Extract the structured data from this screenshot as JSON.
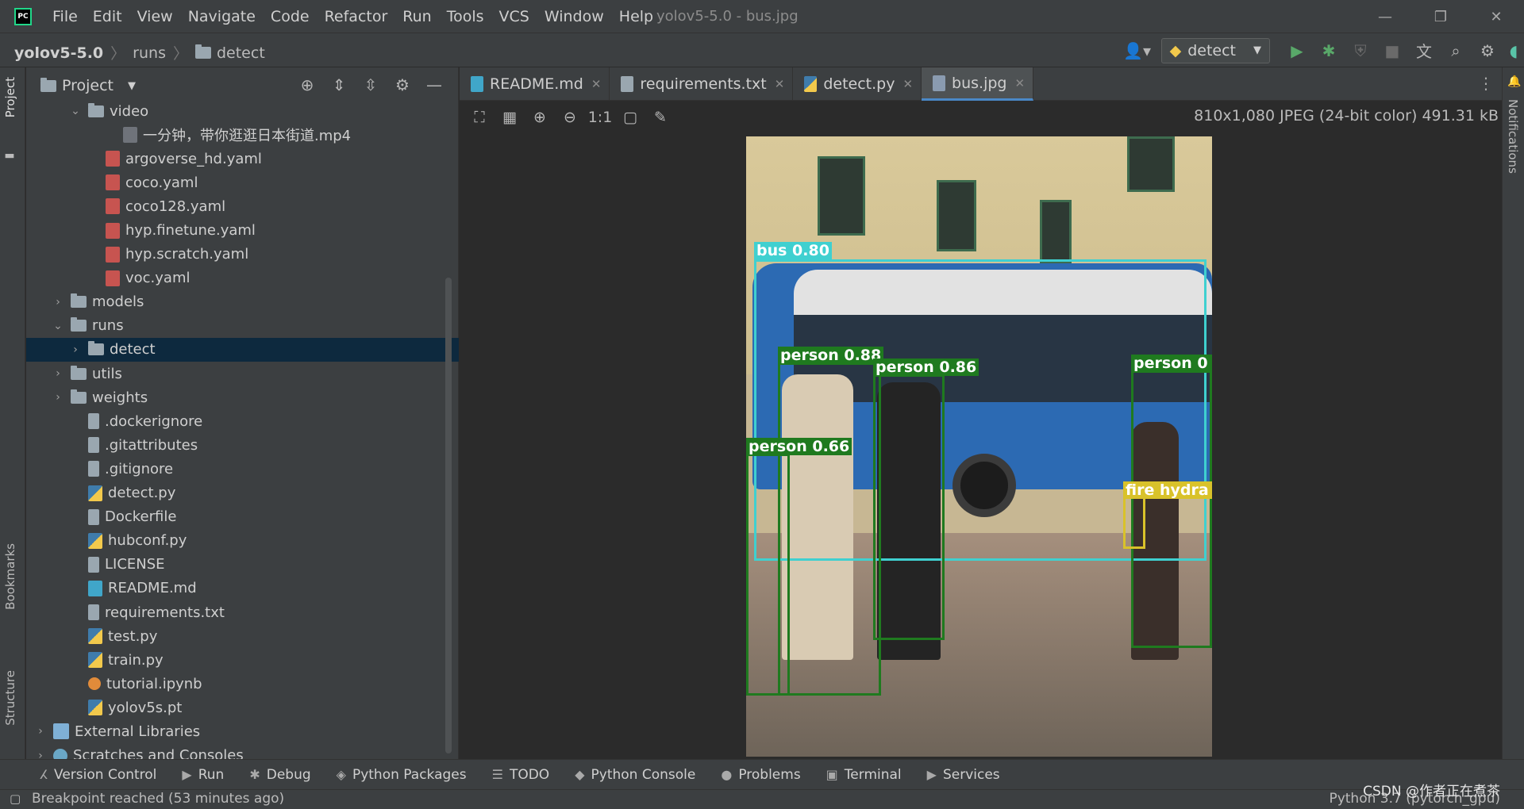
{
  "window": {
    "title": "yolov5-5.0 - bus.jpg",
    "menu": [
      "File",
      "Edit",
      "View",
      "Navigate",
      "Code",
      "Refactor",
      "Run",
      "Tools",
      "VCS",
      "Window",
      "Help"
    ],
    "controls": {
      "minimize": "—",
      "restore": "❐",
      "close": "✕"
    }
  },
  "navbar": {
    "crumbs": [
      "yolov5-5.0",
      "runs",
      "detect"
    ],
    "run_config": "detect"
  },
  "side_tabs": {
    "project": "Project",
    "bookmarks": "Bookmarks",
    "structure": "Structure",
    "notifications": "Notifications"
  },
  "project_panel": {
    "title": "Project",
    "tree": [
      {
        "name": "video",
        "kind": "folder",
        "indent": 2,
        "arrow": "⌄"
      },
      {
        "name": "一分钟，带你逛逛日本街道.mp4",
        "kind": "mp4",
        "indent": 4,
        "arrow": ""
      },
      {
        "name": "argoverse_hd.yaml",
        "kind": "yaml",
        "indent": 3,
        "arrow": ""
      },
      {
        "name": "coco.yaml",
        "kind": "yaml",
        "indent": 3,
        "arrow": ""
      },
      {
        "name": "coco128.yaml",
        "kind": "yaml",
        "indent": 3,
        "arrow": ""
      },
      {
        "name": "hyp.finetune.yaml",
        "kind": "yaml",
        "indent": 3,
        "arrow": ""
      },
      {
        "name": "hyp.scratch.yaml",
        "kind": "yaml",
        "indent": 3,
        "arrow": ""
      },
      {
        "name": "voc.yaml",
        "kind": "yaml",
        "indent": 3,
        "arrow": ""
      },
      {
        "name": "models",
        "kind": "folder",
        "indent": 1,
        "arrow": "›"
      },
      {
        "name": "runs",
        "kind": "folder",
        "indent": 1,
        "arrow": "⌄"
      },
      {
        "name": "detect",
        "kind": "folder",
        "indent": 2,
        "arrow": "›",
        "selected": true
      },
      {
        "name": "utils",
        "kind": "folder",
        "indent": 1,
        "arrow": "›"
      },
      {
        "name": "weights",
        "kind": "folder",
        "indent": 1,
        "arrow": "›"
      },
      {
        "name": ".dockerignore",
        "kind": "text",
        "indent": 2,
        "arrow": ""
      },
      {
        "name": ".gitattributes",
        "kind": "text",
        "indent": 2,
        "arrow": ""
      },
      {
        "name": ".gitignore",
        "kind": "git",
        "indent": 2,
        "arrow": ""
      },
      {
        "name": "detect.py",
        "kind": "py",
        "indent": 2,
        "arrow": ""
      },
      {
        "name": "Dockerfile",
        "kind": "text",
        "indent": 2,
        "arrow": ""
      },
      {
        "name": "hubconf.py",
        "kind": "py",
        "indent": 2,
        "arrow": ""
      },
      {
        "name": "LICENSE",
        "kind": "text",
        "indent": 2,
        "arrow": ""
      },
      {
        "name": "README.md",
        "kind": "md",
        "indent": 2,
        "arrow": ""
      },
      {
        "name": "requirements.txt",
        "kind": "text",
        "indent": 2,
        "arrow": ""
      },
      {
        "name": "test.py",
        "kind": "py",
        "indent": 2,
        "arrow": ""
      },
      {
        "name": "train.py",
        "kind": "py",
        "indent": 2,
        "arrow": ""
      },
      {
        "name": "tutorial.ipynb",
        "kind": "nb",
        "indent": 2,
        "arrow": ""
      },
      {
        "name": "yolov5s.pt",
        "kind": "py",
        "indent": 2,
        "arrow": ""
      },
      {
        "name": "External Libraries",
        "kind": "lib",
        "indent": 0,
        "arrow": "›"
      },
      {
        "name": "Scratches and Consoles",
        "kind": "scratch",
        "indent": 0,
        "arrow": "›"
      }
    ]
  },
  "editor": {
    "tabs": [
      {
        "label": "README.md",
        "icon": "md",
        "active": false
      },
      {
        "label": "requirements.txt",
        "icon": "text",
        "active": false
      },
      {
        "label": "detect.py",
        "icon": "py",
        "active": false
      },
      {
        "label": "bus.jpg",
        "icon": "img",
        "active": true
      }
    ],
    "image_toolbar": [
      "⛶",
      "▦",
      "⊕",
      "⊖",
      "1:1",
      "▢",
      "✎"
    ],
    "image_info": "810x1,080 JPEG (24-bit color) 491.31 kB"
  },
  "detections": [
    {
      "label": "bus 0.80",
      "color": "#3fd0d0"
    },
    {
      "label": "person 0.88",
      "color": "#1f7a1f"
    },
    {
      "label": "person 0.86",
      "color": "#1f7a1f"
    },
    {
      "label": "person 0",
      "color": "#1f7a1f"
    },
    {
      "label": "person 0.66",
      "color": "#1f7a1f"
    },
    {
      "label": "fire hydra",
      "color": "#d9c22a"
    }
  ],
  "bottom_tools": [
    {
      "label": "Version Control",
      "icon": "ⵃ"
    },
    {
      "label": "Run",
      "icon": "▶"
    },
    {
      "label": "Debug",
      "icon": "✱"
    },
    {
      "label": "Python Packages",
      "icon": "◈"
    },
    {
      "label": "TODO",
      "icon": "☰"
    },
    {
      "label": "Python Console",
      "icon": "◆"
    },
    {
      "label": "Problems",
      "icon": "●"
    },
    {
      "label": "Terminal",
      "icon": "▣"
    },
    {
      "label": "Services",
      "icon": "▶"
    }
  ],
  "status": {
    "message": "Breakpoint reached (53 minutes ago)",
    "interpreter": "Python 3.7 (pytorch_gpu)",
    "watermark": "CSDN @作者正在煮茶"
  },
  "colors": {
    "accent": "#4a88c7",
    "selection": "#0d293e",
    "run_green": "#59a869"
  }
}
